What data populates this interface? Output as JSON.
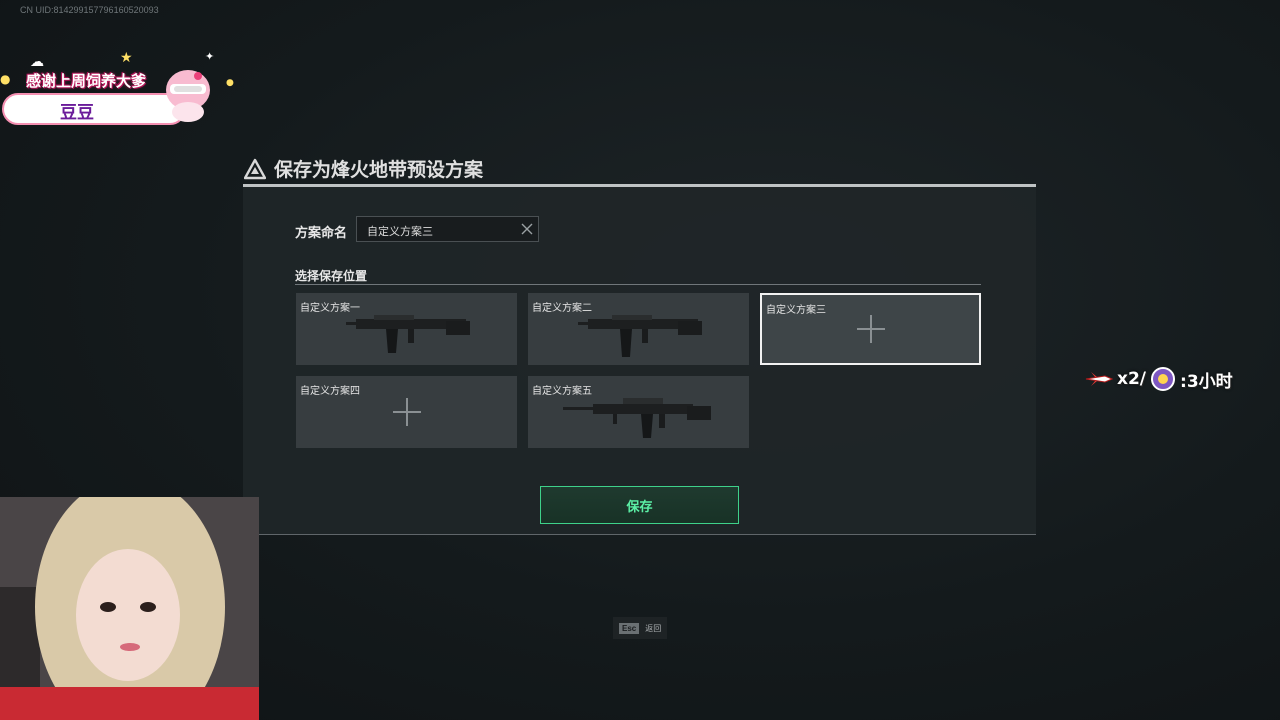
{
  "uid_text": "CN UID:814299157796160520093",
  "stream_overlay": {
    "gift_banner_title": "感谢上周饲养大爹",
    "gift_banner_name": "豆豆",
    "gift_counter_text": "x2/",
    "gift_counter_time": ":3小时"
  },
  "dialog": {
    "title": "保存为烽火地带预设方案",
    "name_label": "方案命名",
    "name_value": "自定义方案三",
    "location_label": "选择保存位置",
    "slots": [
      {
        "label": "自定义方案一",
        "state": "weapon"
      },
      {
        "label": "自定义方案二",
        "state": "weapon"
      },
      {
        "label": "自定义方案三",
        "state": "empty-selected"
      },
      {
        "label": "自定义方案四",
        "state": "empty"
      },
      {
        "label": "自定义方案五",
        "state": "weapon"
      }
    ],
    "save_label": "保存"
  },
  "footer": {
    "esc_key": "Esc",
    "esc_label": "返回"
  },
  "colors": {
    "accent_green": "#3ed18a",
    "panel": "#202628",
    "slot_bg": "#373d40"
  }
}
